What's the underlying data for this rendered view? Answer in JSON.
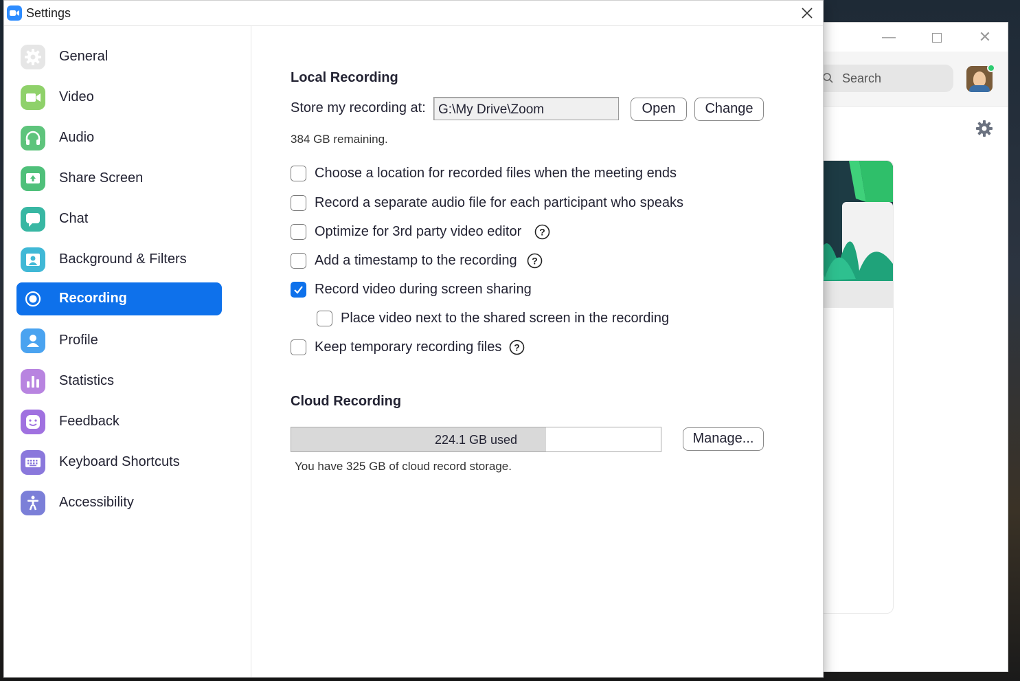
{
  "settings_window": {
    "title": "Settings"
  },
  "sidebar": {
    "items": [
      {
        "label": "General",
        "icon": "gear-icon",
        "color": "#e8e8e8"
      },
      {
        "label": "Video",
        "icon": "video-camera-icon",
        "color": "#8fd16a"
      },
      {
        "label": "Audio",
        "icon": "headphones-icon",
        "color": "#5ec47c"
      },
      {
        "label": "Share Screen",
        "icon": "share-screen-icon",
        "color": "#4fc07a"
      },
      {
        "label": "Chat",
        "icon": "chat-bubble-icon",
        "color": "#38b7a3"
      },
      {
        "label": "Background & Filters",
        "icon": "person-portrait-icon",
        "color": "#40b8d6"
      },
      {
        "label": "Recording",
        "icon": "record-icon",
        "color": "#0e71eb",
        "active": true
      },
      {
        "label": "Profile",
        "icon": "user-icon",
        "color": "#4aa3f0"
      },
      {
        "label": "Statistics",
        "icon": "bar-chart-icon",
        "color": "#b884e0"
      },
      {
        "label": "Feedback",
        "icon": "smiley-icon",
        "color": "#a071e0"
      },
      {
        "label": "Keyboard Shortcuts",
        "icon": "keyboard-icon",
        "color": "#8a78dc"
      },
      {
        "label": "Accessibility",
        "icon": "accessibility-icon",
        "color": "#7b7fd8"
      }
    ]
  },
  "local_recording": {
    "title": "Local Recording",
    "store_label": "Store my recording at:",
    "path": "G:\\My Drive\\Zoom",
    "open_label": "Open",
    "change_label": "Change",
    "remaining": "384 GB remaining.",
    "options": [
      {
        "label": "Choose a location for recorded files when the meeting ends",
        "checked": false,
        "help": false
      },
      {
        "label": "Record a separate audio file for each participant who speaks",
        "checked": false,
        "help": false
      },
      {
        "label": "Optimize for 3rd party video editor",
        "checked": false,
        "help": true
      },
      {
        "label": "Add a timestamp to the recording",
        "checked": false,
        "help": true
      },
      {
        "label": "Record video during screen sharing",
        "checked": true,
        "help": false
      },
      {
        "label": "Place video next to the shared screen in the recording",
        "checked": false,
        "help": false,
        "indent": true
      },
      {
        "label": "Keep temporary recording files",
        "checked": false,
        "help": true
      }
    ]
  },
  "cloud_recording": {
    "title": "Cloud Recording",
    "used_label": "224.1 GB used",
    "used_fraction": 0.69,
    "manage_label": "Manage...",
    "storage_note": "You have 325 GB of cloud record storage."
  },
  "background_window": {
    "search_placeholder": "Search",
    "status_color": "#2ecc71"
  },
  "colors": {
    "accent": "#0e71eb",
    "text": "#232333"
  }
}
